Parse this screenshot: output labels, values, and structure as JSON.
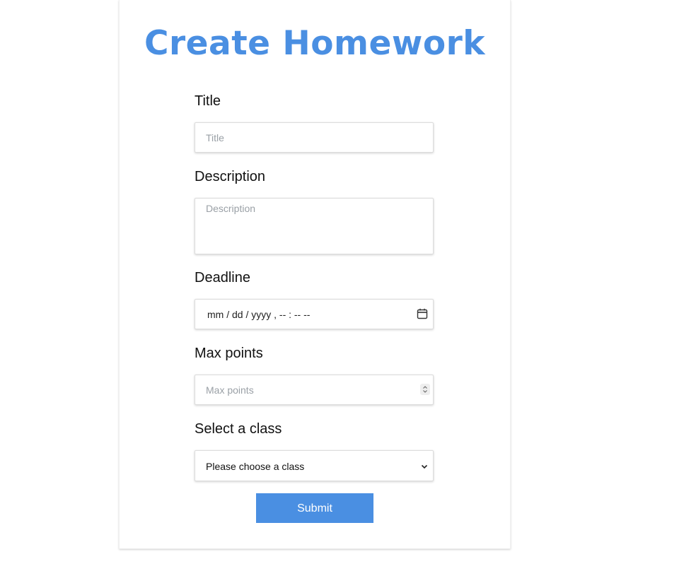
{
  "page": {
    "title": "Create Homework",
    "accent_color": "#4a8fe2"
  },
  "form": {
    "title": {
      "label": "Title",
      "placeholder": "Title",
      "value": ""
    },
    "description": {
      "label": "Description",
      "placeholder": "Description",
      "value": ""
    },
    "deadline": {
      "label": "Deadline",
      "display": "mm / dd / yyyy ,  -- : --   --",
      "icon": "calendar-icon"
    },
    "max_points": {
      "label": "Max points",
      "placeholder": "Max points",
      "value": "",
      "icon": "spinner-icon"
    },
    "class_select": {
      "label": "Select a class",
      "selected": "Please choose a class",
      "icon": "chevron-down-icon"
    },
    "submit_label": "Submit"
  }
}
